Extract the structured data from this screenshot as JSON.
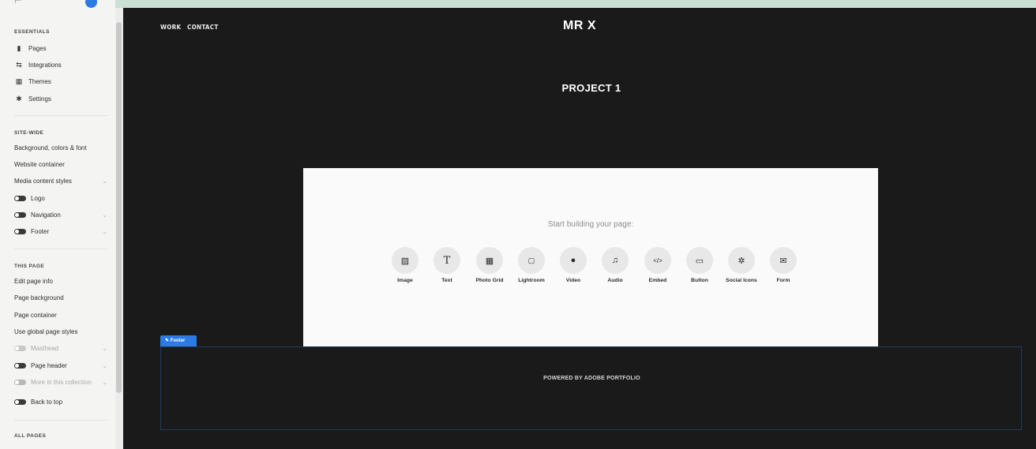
{
  "sidebar": {
    "sections": {
      "essentials": "ESSENTIALS",
      "site_wide": "SITE-WIDE",
      "this_page": "THIS PAGE",
      "all_pages": "ALL PAGES"
    },
    "essentials": [
      {
        "label": "Pages",
        "icon": "page-icon"
      },
      {
        "label": "Integrations",
        "icon": "integrations-icon"
      },
      {
        "label": "Themes",
        "icon": "themes-icon"
      },
      {
        "label": "Settings",
        "icon": "gear-icon"
      }
    ],
    "site_wide": [
      {
        "label": "Background, colors & font"
      },
      {
        "label": "Website container"
      },
      {
        "label": "Media content styles"
      },
      {
        "label": "Logo",
        "toggle": "on"
      },
      {
        "label": "Navigation",
        "toggle": "on"
      },
      {
        "label": "Footer",
        "toggle": "on"
      }
    ],
    "this_page": [
      {
        "label": "Edit page info"
      },
      {
        "label": "Page background"
      },
      {
        "label": "Page container"
      },
      {
        "label": "Use global page styles"
      },
      {
        "label": "Masthead",
        "toggle": "off"
      },
      {
        "label": "Page header",
        "toggle": "on"
      },
      {
        "label": "More in this collection",
        "toggle": "dim"
      },
      {
        "label": "Back to top",
        "toggle": "on"
      }
    ]
  },
  "site": {
    "nav": [
      "WORK",
      "CONTACT"
    ],
    "title": "MR X",
    "project_title": "PROJECT 1"
  },
  "builder": {
    "prompt": "Start building your page:",
    "blocks": [
      {
        "label": "Image",
        "icon": "image-icon"
      },
      {
        "label": "Text",
        "icon": "text-icon"
      },
      {
        "label": "Photo Grid",
        "icon": "photo-grid-icon"
      },
      {
        "label": "Lightroom",
        "icon": "lightroom-icon"
      },
      {
        "label": "Video",
        "icon": "play-icon"
      },
      {
        "label": "Audio",
        "icon": "music-note-icon"
      },
      {
        "label": "Embed",
        "icon": "code-icon"
      },
      {
        "label": "Button",
        "icon": "button-icon"
      },
      {
        "label": "Social Icons",
        "icon": "social-icon"
      },
      {
        "label": "Form",
        "icon": "envelope-icon"
      }
    ]
  },
  "footer": {
    "tag": "Footer",
    "text": "POWERED BY ADOBE PORTFOLIO"
  },
  "colors": {
    "accent": "#2c7be5",
    "canvas_bg": "#1a1a1a",
    "sidebar_bg": "#f4f5f3"
  }
}
